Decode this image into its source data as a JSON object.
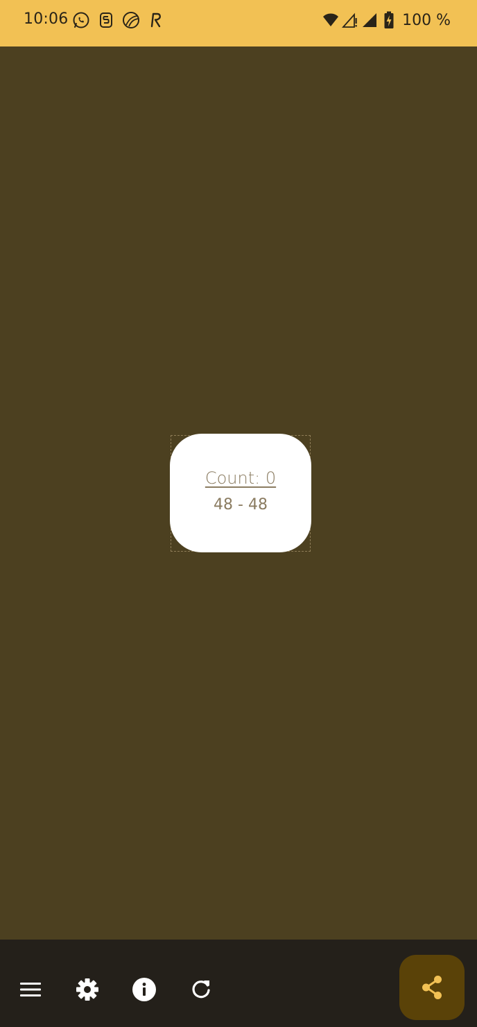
{
  "status_bar": {
    "time": "10:06",
    "battery": "100 %",
    "notification_icons": [
      "whatsapp-icon",
      "s-app-icon",
      "globe-icon",
      "r-app-icon"
    ],
    "system_icons": [
      "wifi-icon",
      "cell-signal-icon",
      "cell-signal-full-icon",
      "battery-charging-icon"
    ]
  },
  "card": {
    "count_label": "Count: 0",
    "range_label": "48 - 48"
  },
  "bottom_bar": {
    "buttons": [
      "menu-icon",
      "settings-icon",
      "info-icon",
      "refresh-icon"
    ],
    "fab_icon": "share-icon"
  },
  "colors": {
    "status_bar": "#f2c154",
    "background": "#4c4020",
    "card": "#ffffff",
    "bottom_bar": "#24201a",
    "fab": "#5a4208",
    "fab_icon": "#f2c154"
  }
}
